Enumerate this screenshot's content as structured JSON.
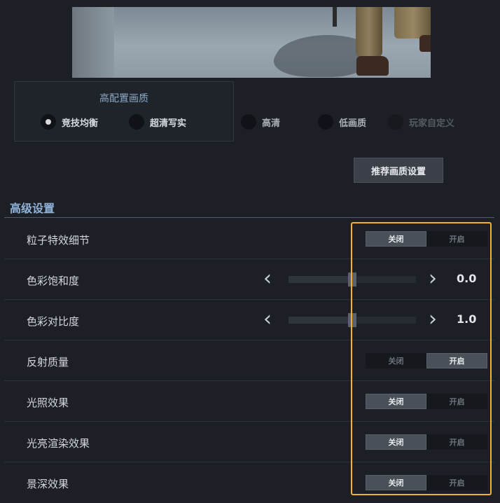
{
  "quality": {
    "title": "高配置画质",
    "options": [
      {
        "label": "竞技均衡",
        "checked": true
      },
      {
        "label": "超清写实",
        "checked": false
      },
      {
        "label": "高清",
        "checked": false
      },
      {
        "label": "低画质",
        "checked": false
      },
      {
        "label": "玩家自定义",
        "checked": false
      }
    ]
  },
  "recommend_button": "推荐画质设置",
  "advanced": {
    "title": "高级设置",
    "toggle_labels": {
      "off": "关闭",
      "on": "开启"
    },
    "rows": [
      {
        "label": "粒子特效细节",
        "type": "toggle",
        "state": "off"
      },
      {
        "label": "色彩饱和度",
        "type": "slider",
        "value": "0.0",
        "level": 0.5
      },
      {
        "label": "色彩对比度",
        "type": "slider",
        "value": "1.0",
        "level": 0.5
      },
      {
        "label": "反射质量",
        "type": "toggle",
        "state": "on"
      },
      {
        "label": "光照效果",
        "type": "toggle",
        "state": "off"
      },
      {
        "label": "光亮渲染效果",
        "type": "toggle",
        "state": "off"
      },
      {
        "label": "景深效果",
        "type": "toggle",
        "state": "off"
      }
    ]
  },
  "colors": {
    "highlight": "#f3b32d",
    "accent": "#8fb3d9"
  }
}
